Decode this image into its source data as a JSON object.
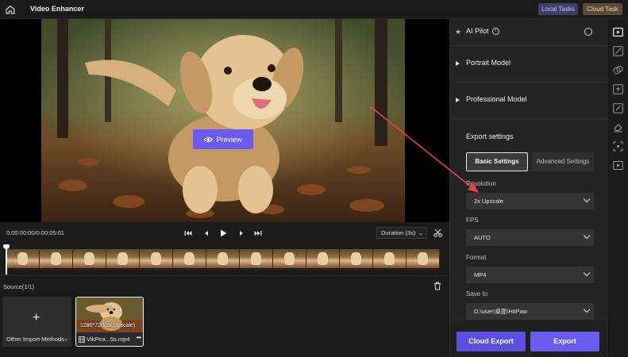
{
  "app": {
    "title": "Video Enhancer"
  },
  "header": {
    "local_tasks": "Local Tasks",
    "cloud_task": "Cloud Task"
  },
  "preview": {
    "button_label": "Preview"
  },
  "transport": {
    "timecode": "0:00:00:00/0:00:05:01",
    "duration_label": "Duration (3s)"
  },
  "source": {
    "title": "Source(1/1)",
    "import_label": "Other Import Methods",
    "video": {
      "resolution": "1280*720(2x Upscale)",
      "filename": "VikPea...5s.mp4",
      "more": "•••"
    }
  },
  "panel": {
    "ai_pilot": "AI Pilot",
    "portrait_model": "Portrait Model",
    "professional_model": "Professional Model",
    "export_settings": "Export settings",
    "tabs": {
      "basic": "Basic Settings",
      "advanced": "Advanced Settings"
    },
    "resolution": {
      "label": "Resolution",
      "value": "2x Upscale"
    },
    "fps": {
      "label": "FPS",
      "value": "AUTO"
    },
    "format": {
      "label": "Format",
      "value": "MP4"
    },
    "save_to": {
      "label": "Save to",
      "value": "D:\\user\\桌面\\HitPaw"
    },
    "cloud_export": "Cloud Export",
    "export": "Export"
  },
  "colors": {
    "accent": "#6a5cf2",
    "annotation_arrow": "#e0463f",
    "star": "#f0b23a"
  },
  "icons": [
    "home-icon",
    "eye-icon",
    "skip-back-icon",
    "prev-frame-icon",
    "play-icon",
    "next-frame-icon",
    "skip-forward-icon",
    "scissors-icon",
    "trash-icon",
    "plus-icon",
    "film-icon",
    "star-icon",
    "info-icon",
    "video-enhance-tool-icon",
    "brush-tool-icon",
    "colorize-tool-icon",
    "edit-tool-icon",
    "eraser-tool-icon",
    "frame-select-tool-icon",
    "video-add-tool-icon"
  ]
}
